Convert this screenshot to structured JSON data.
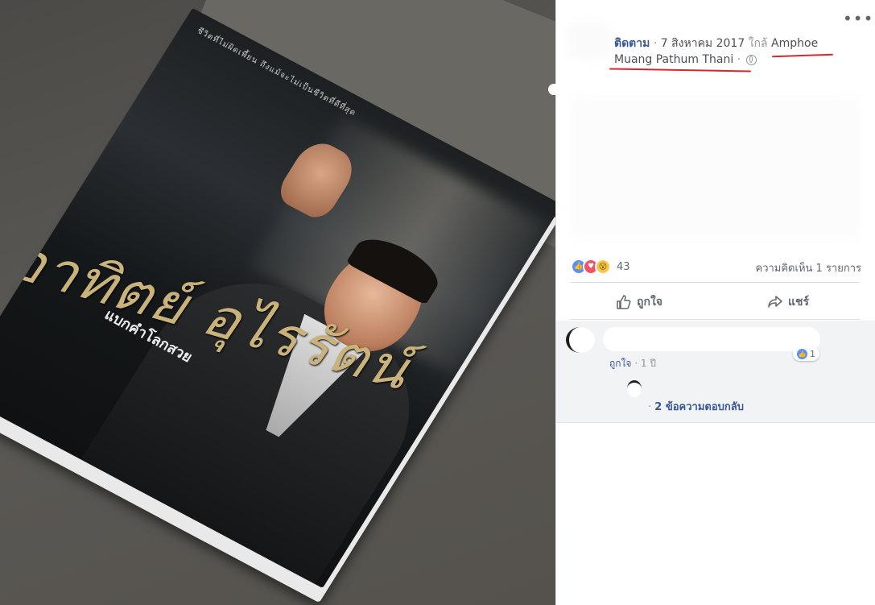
{
  "photo": {
    "book_title": "อาทิตย์ อุไรรัตน์",
    "book_subtitle": "แบกคำโลกสวย",
    "book_top_text": "ชีวิตที่ไม่ผิดเพี้ยน ถึงแม้จะไม่เป็นชีวิตที่ดีที่สุด"
  },
  "post": {
    "more_label": "•••",
    "follow_label": "ติดตาม",
    "sep1": " · ",
    "date": "7 สิงหาคม 2017",
    "near_label": " ใกล้ ",
    "location_line1": "Amphoe",
    "location_line2": "Muang Pathum Thani",
    "sep2": " · ",
    "privacy_icon": "globe-icon"
  },
  "reactions": {
    "count": "43",
    "comment_count": "ความคิดเห็น 1 รายการ",
    "icons": [
      "like-icon",
      "love-icon",
      "wow-icon"
    ]
  },
  "actions": {
    "like_label": "ถูกใจ",
    "share_label": "แชร์"
  },
  "comment": {
    "name": "",
    "text": "",
    "reaction_count": "1",
    "like_link": "ถูกใจ",
    "sep": " · ",
    "age": "1 ปี",
    "replies_dot": "· ",
    "replies_label": "2 ข้อความตอบกลับ"
  },
  "colors": {
    "link_blue": "#385898",
    "annotation_red": "#d9262c",
    "like_blue": "#5890ff",
    "love_red": "#f25268",
    "wow_yellow": "#f7c84b"
  }
}
